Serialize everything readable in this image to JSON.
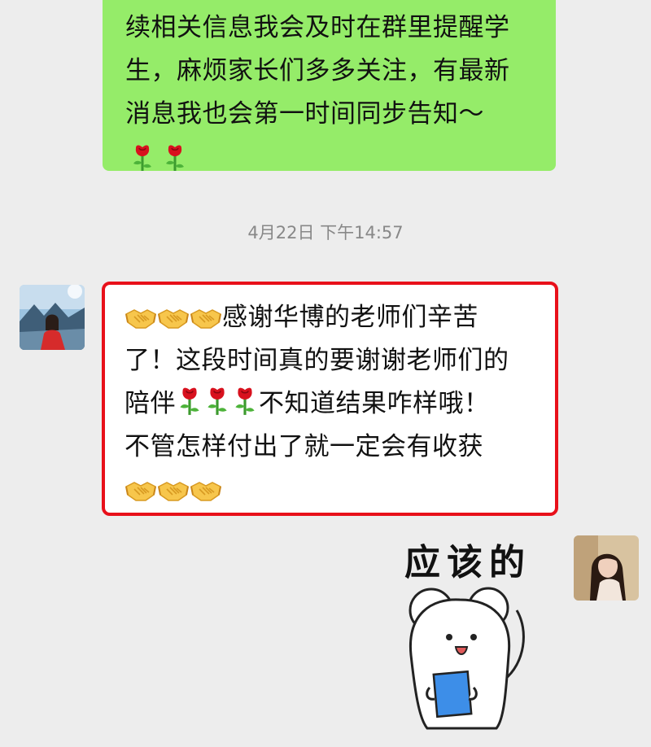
{
  "chat": {
    "outgoing_message": {
      "lines": [
        "续相关信息我会及时在群里提醒学",
        "生，麻烦家长们多多关注，有最新",
        "消息我也会第一时间同步告知～"
      ],
      "emoji": [
        "rose",
        "rose"
      ]
    },
    "timestamp": "4月22日 下午14:57",
    "incoming_message": {
      "line1_text": "感谢华博的老师们辛苦",
      "line2": "了！这段时间真的要谢谢老师们的",
      "line3_prefix": "陪伴",
      "line3_suffix": "不知道结果咋样哦！",
      "line4": "不管怎样付出了就一定会有收获",
      "highlight_color": "#e8101a"
    },
    "sticker": {
      "caption": "应该的"
    }
  },
  "colors": {
    "outgoing_bubble": "#95ec69",
    "incoming_bubble": "#ffffff",
    "background": "#ededed"
  }
}
